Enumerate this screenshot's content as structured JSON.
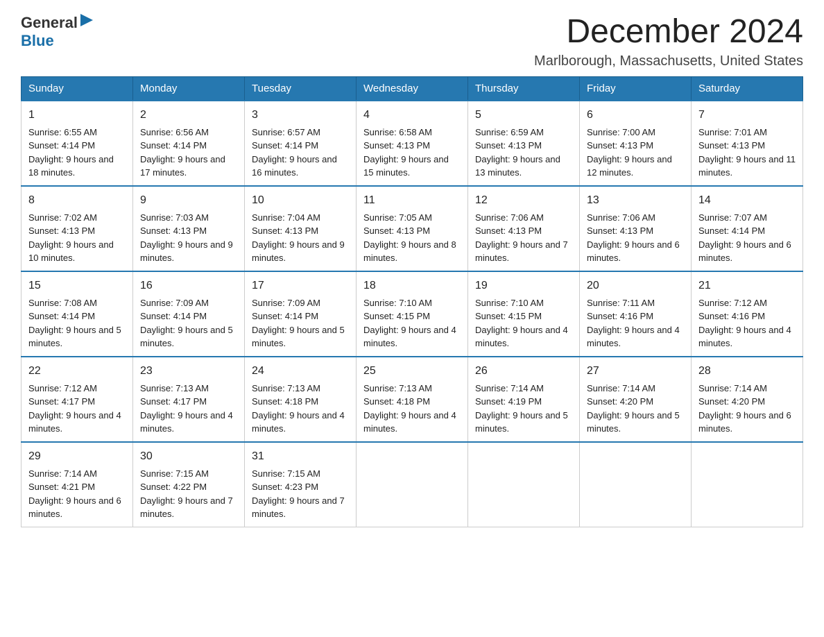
{
  "logo": {
    "general": "General",
    "blue": "Blue"
  },
  "title": "December 2024",
  "location": "Marlborough, Massachusetts, United States",
  "weekdays": [
    "Sunday",
    "Monday",
    "Tuesday",
    "Wednesday",
    "Thursday",
    "Friday",
    "Saturday"
  ],
  "weeks": [
    [
      {
        "day": "1",
        "sunrise": "6:55 AM",
        "sunset": "4:14 PM",
        "daylight": "9 hours and 18 minutes."
      },
      {
        "day": "2",
        "sunrise": "6:56 AM",
        "sunset": "4:14 PM",
        "daylight": "9 hours and 17 minutes."
      },
      {
        "day": "3",
        "sunrise": "6:57 AM",
        "sunset": "4:14 PM",
        "daylight": "9 hours and 16 minutes."
      },
      {
        "day": "4",
        "sunrise": "6:58 AM",
        "sunset": "4:13 PM",
        "daylight": "9 hours and 15 minutes."
      },
      {
        "day": "5",
        "sunrise": "6:59 AM",
        "sunset": "4:13 PM",
        "daylight": "9 hours and 13 minutes."
      },
      {
        "day": "6",
        "sunrise": "7:00 AM",
        "sunset": "4:13 PM",
        "daylight": "9 hours and 12 minutes."
      },
      {
        "day": "7",
        "sunrise": "7:01 AM",
        "sunset": "4:13 PM",
        "daylight": "9 hours and 11 minutes."
      }
    ],
    [
      {
        "day": "8",
        "sunrise": "7:02 AM",
        "sunset": "4:13 PM",
        "daylight": "9 hours and 10 minutes."
      },
      {
        "day": "9",
        "sunrise": "7:03 AM",
        "sunset": "4:13 PM",
        "daylight": "9 hours and 9 minutes."
      },
      {
        "day": "10",
        "sunrise": "7:04 AM",
        "sunset": "4:13 PM",
        "daylight": "9 hours and 9 minutes."
      },
      {
        "day": "11",
        "sunrise": "7:05 AM",
        "sunset": "4:13 PM",
        "daylight": "9 hours and 8 minutes."
      },
      {
        "day": "12",
        "sunrise": "7:06 AM",
        "sunset": "4:13 PM",
        "daylight": "9 hours and 7 minutes."
      },
      {
        "day": "13",
        "sunrise": "7:06 AM",
        "sunset": "4:13 PM",
        "daylight": "9 hours and 6 minutes."
      },
      {
        "day": "14",
        "sunrise": "7:07 AM",
        "sunset": "4:14 PM",
        "daylight": "9 hours and 6 minutes."
      }
    ],
    [
      {
        "day": "15",
        "sunrise": "7:08 AM",
        "sunset": "4:14 PM",
        "daylight": "9 hours and 5 minutes."
      },
      {
        "day": "16",
        "sunrise": "7:09 AM",
        "sunset": "4:14 PM",
        "daylight": "9 hours and 5 minutes."
      },
      {
        "day": "17",
        "sunrise": "7:09 AM",
        "sunset": "4:14 PM",
        "daylight": "9 hours and 5 minutes."
      },
      {
        "day": "18",
        "sunrise": "7:10 AM",
        "sunset": "4:15 PM",
        "daylight": "9 hours and 4 minutes."
      },
      {
        "day": "19",
        "sunrise": "7:10 AM",
        "sunset": "4:15 PM",
        "daylight": "9 hours and 4 minutes."
      },
      {
        "day": "20",
        "sunrise": "7:11 AM",
        "sunset": "4:16 PM",
        "daylight": "9 hours and 4 minutes."
      },
      {
        "day": "21",
        "sunrise": "7:12 AM",
        "sunset": "4:16 PM",
        "daylight": "9 hours and 4 minutes."
      }
    ],
    [
      {
        "day": "22",
        "sunrise": "7:12 AM",
        "sunset": "4:17 PM",
        "daylight": "9 hours and 4 minutes."
      },
      {
        "day": "23",
        "sunrise": "7:13 AM",
        "sunset": "4:17 PM",
        "daylight": "9 hours and 4 minutes."
      },
      {
        "day": "24",
        "sunrise": "7:13 AM",
        "sunset": "4:18 PM",
        "daylight": "9 hours and 4 minutes."
      },
      {
        "day": "25",
        "sunrise": "7:13 AM",
        "sunset": "4:18 PM",
        "daylight": "9 hours and 4 minutes."
      },
      {
        "day": "26",
        "sunrise": "7:14 AM",
        "sunset": "4:19 PM",
        "daylight": "9 hours and 5 minutes."
      },
      {
        "day": "27",
        "sunrise": "7:14 AM",
        "sunset": "4:20 PM",
        "daylight": "9 hours and 5 minutes."
      },
      {
        "day": "28",
        "sunrise": "7:14 AM",
        "sunset": "4:20 PM",
        "daylight": "9 hours and 6 minutes."
      }
    ],
    [
      {
        "day": "29",
        "sunrise": "7:14 AM",
        "sunset": "4:21 PM",
        "daylight": "9 hours and 6 minutes."
      },
      {
        "day": "30",
        "sunrise": "7:15 AM",
        "sunset": "4:22 PM",
        "daylight": "9 hours and 7 minutes."
      },
      {
        "day": "31",
        "sunrise": "7:15 AM",
        "sunset": "4:23 PM",
        "daylight": "9 hours and 7 minutes."
      },
      null,
      null,
      null,
      null
    ]
  ]
}
